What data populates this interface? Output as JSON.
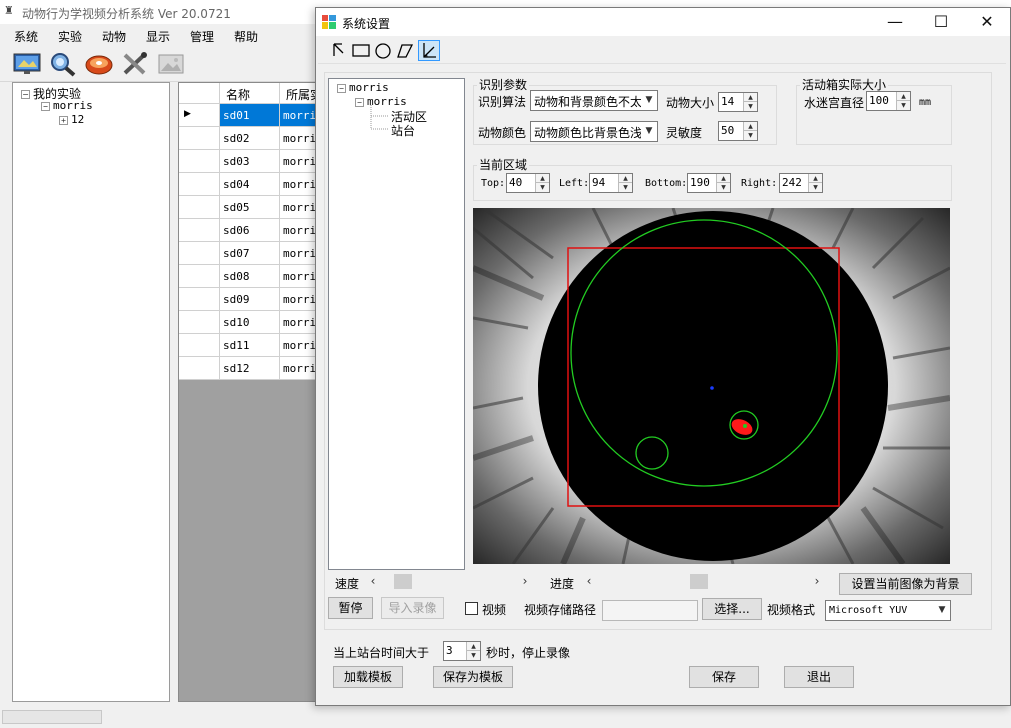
{
  "app": {
    "title": "动物行为学视频分析系统 Ver 20.0721",
    "menu": [
      "系统",
      "实验",
      "动物",
      "显示",
      "管理",
      "帮助"
    ],
    "toolbar_icons": [
      "monitor-icon",
      "search-icon",
      "disc-icon",
      "tools-icon",
      "image-icon"
    ],
    "tree": {
      "root": "我的实验",
      "child": "morris",
      "leaf": "12"
    },
    "grid": {
      "headers": [
        "名称",
        "所属实"
      ],
      "rows": [
        {
          "name": "sd01",
          "group": "morris"
        },
        {
          "name": "sd02",
          "group": "morris"
        },
        {
          "name": "sd03",
          "group": "morris"
        },
        {
          "name": "sd04",
          "group": "morris"
        },
        {
          "name": "sd05",
          "group": "morris"
        },
        {
          "name": "sd06",
          "group": "morris"
        },
        {
          "name": "sd07",
          "group": "morris"
        },
        {
          "name": "sd08",
          "group": "morris"
        },
        {
          "name": "sd09",
          "group": "morris"
        },
        {
          "name": "sd10",
          "group": "morris"
        },
        {
          "name": "sd11",
          "group": "morris"
        },
        {
          "name": "sd12",
          "group": "morris"
        }
      ],
      "selected_row": "sd01",
      "row_marker": "▶"
    }
  },
  "dialog": {
    "title": "系统设置",
    "window_controls": {
      "minimize": "—",
      "maximize": "☐",
      "close": "✕"
    },
    "shape_tools": [
      "pointer-icon",
      "rectangle-icon",
      "circle-icon",
      "polygon-icon",
      "angle-icon"
    ],
    "active_tool": "angle-icon",
    "tree": {
      "root": "morris",
      "child": "morris",
      "items": [
        "活动区",
        "站台"
      ]
    },
    "recognition": {
      "group_label": "识别参数",
      "algorithm_label": "识别算法",
      "algorithm_value": "动物和背景颜色不太",
      "animal_size_label": "动物大小",
      "animal_size_value": "14",
      "animal_color_label": "动物颜色",
      "animal_color_value": "动物颜色比背景色浅",
      "sensitivity_label": "灵敏度",
      "sensitivity_value": "50"
    },
    "box_size": {
      "group_label": "活动箱实际大小",
      "diameter_label": "水迷宫直径",
      "diameter_value": "100",
      "unit": "mm"
    },
    "region": {
      "group_label": "当前区域",
      "top_label": "Top:",
      "top_value": "40",
      "left_label": "Left:",
      "left_value": "94",
      "bottom_label": "Bottom:",
      "bottom_value": "190",
      "right_label": "Right:",
      "right_value": "242"
    },
    "controls": {
      "speed_label": "速度",
      "progress_label": "进度",
      "set_background_button": "设置当前图像为背景",
      "pause_button": "暂停",
      "import_button": "导入录像",
      "video_checkbox_label": "视频",
      "video_checked": false,
      "storage_path_label": "视频存储路径",
      "storage_path_value": "",
      "select_button": "选择...",
      "format_label": "视频格式",
      "format_value": "Microsoft YUV"
    },
    "footer": {
      "stop_prefix": "当上站台时间大于",
      "stop_value": "3",
      "stop_suffix": "秒时，停止录像",
      "load_template_button": "加载模板",
      "save_template_button": "保存为模板",
      "save_button": "保存",
      "exit_button": "退出"
    },
    "colors": {
      "roi_rectangle": "#e01010",
      "circle_outline": "#22cc22",
      "animal": "#ff1a1a",
      "center_marker": "#1a3cff",
      "selection_blue": "#0078d7"
    }
  }
}
